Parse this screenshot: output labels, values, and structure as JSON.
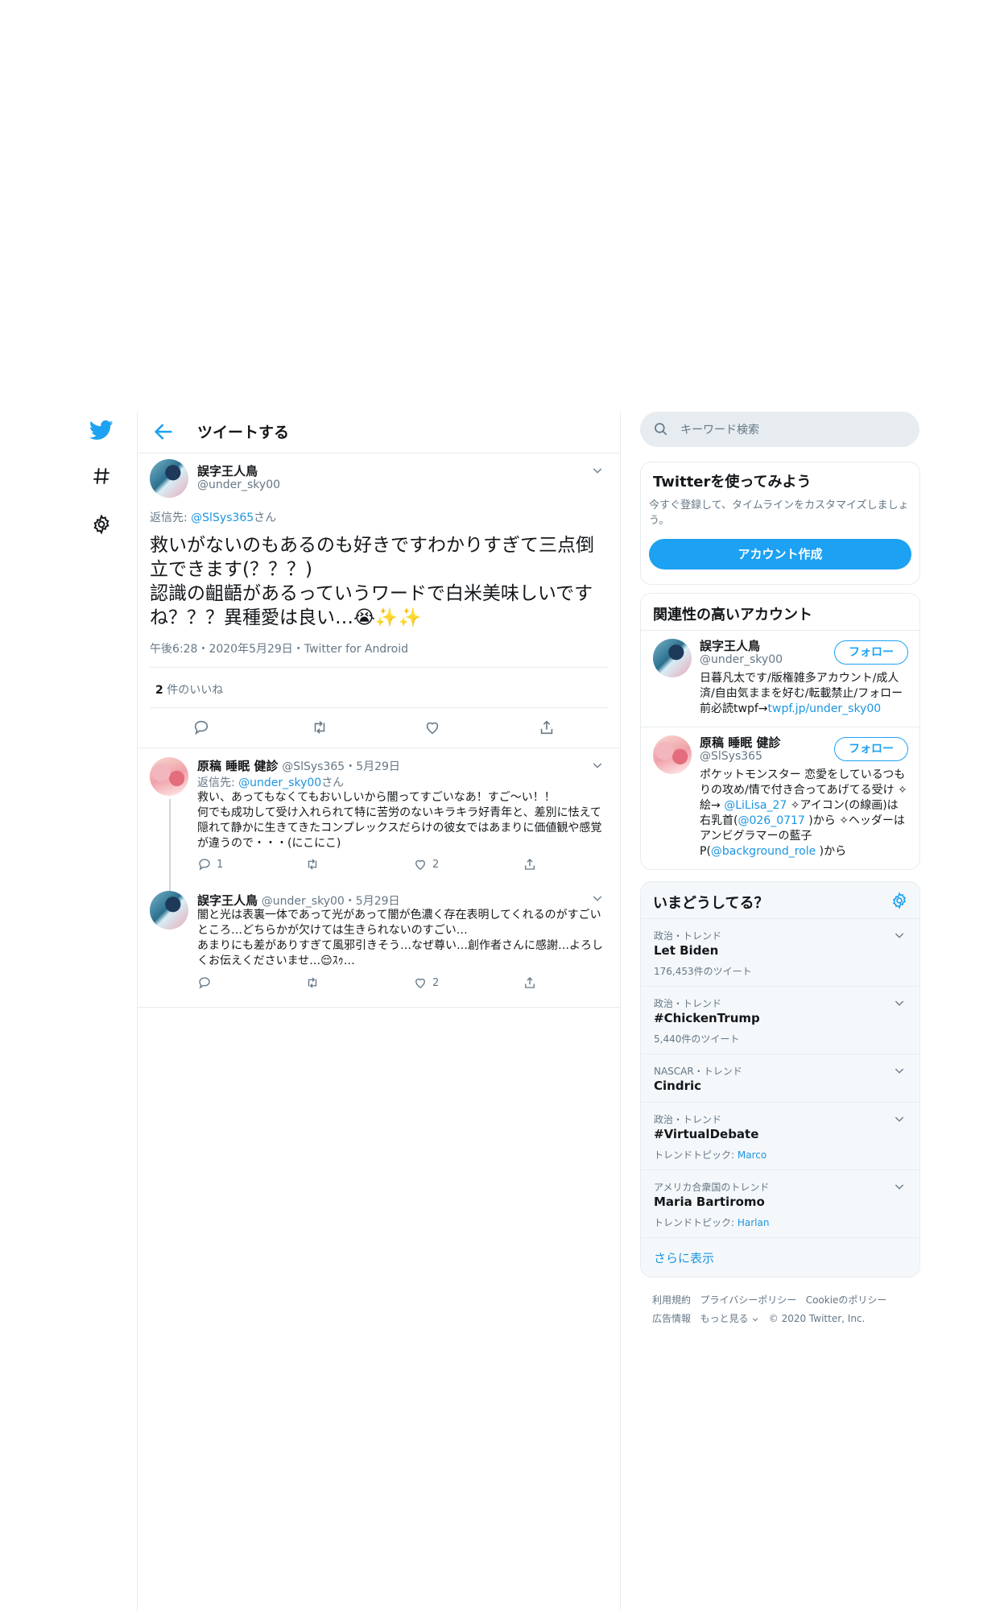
{
  "nav": {
    "twitter_logo": "twitter-bird-icon",
    "explore_icon": "hashtag-icon",
    "settings_icon": "gear-icon"
  },
  "header": {
    "title": "ツイートする"
  },
  "main_tweet": {
    "display_name": "誤字王人鳥",
    "handle": "@under_sky00",
    "reply_prefix": "返信先: ",
    "reply_to": "@SlSys365",
    "reply_suffix": "さん",
    "text": "救いがないのもあるのも好きですわかりすぎて三点倒立できます(？？？)\n認識の齟齬があるっていうワードで白米美味しいですね？？？異種愛は良い…😭✨✨",
    "meta": "午後6:28・2020年5月29日・Twitter for Android",
    "likes_count": "2",
    "likes_label": " 件のいいね"
  },
  "replies": [
    {
      "display_name": "原稿 睡眠 健診",
      "handle_date": "@SlSys365・5月29日",
      "reply_prefix": "返信先: ",
      "reply_to": "@under_sky00",
      "reply_suffix": "さん",
      "text": "救い、あってもなくてもおいしいから闇ってすごいなあ！すご〜い！！\n何でも成功して受け入れられて特に苦労のないキラキラ好青年と、差別に怯えて隠れて静かに生きてきたコンプレックスだらけの彼女ではあまりに価値観や感覚が違うので・・・(にこにこ)",
      "reply_count": "1",
      "like_count": "2"
    },
    {
      "display_name": "誤字王人鳥",
      "handle_date": "@under_sky00・5月29日",
      "text": "闇と光は表裏一体であって光があって闇が色濃く存在表明してくれるのがすごいところ…どちらかが欠けては生きられないのすごい…\nあまりにも差がありすぎて風邪引きそう…なぜ尊い…創作者さんに感謝…よろしくお伝えくださいませ…😌ｽｩ…",
      "like_count": "2"
    }
  ],
  "search": {
    "placeholder": "キーワード検索"
  },
  "signup": {
    "title": "Twitterを使ってみよう",
    "text": "今すぐ登録して、タイムラインをカスタマイズしましょう。",
    "button": "アカウント作成"
  },
  "related": {
    "title": "関連性の高いアカウント",
    "follow_label": "フォロー",
    "accounts": [
      {
        "name": "誤字王人鳥",
        "handle": "@under_sky00",
        "bio": "日暮凡太です/版権雑多アカウント/成人済/自由気ままを好む/転載禁止/フォロー前必読twpf→",
        "bio_link": "twpf.jp/under_sky00"
      },
      {
        "name": "原稿 睡眠 健診",
        "handle": "@SlSys365",
        "bio1": "ポケットモンスター 恋愛をしているつもりの攻め/情で付き合ってあげてる受け ✧絵→ ",
        "link1": "@LiLisa_27",
        "bio2": " ✧アイコン(の線画)は右乳首(",
        "link2": "@026_0717",
        "bio3": " )から ✧ヘッダーはアンビグラマーの藍子P(",
        "link3": "@background_role",
        "bio4": " )から"
      }
    ]
  },
  "trends": {
    "title": "いまどうしてる？",
    "items": [
      {
        "category": "政治・トレンド",
        "name": "Let Biden",
        "sub": "176,453件のツイート"
      },
      {
        "category": "政治・トレンド",
        "name": "#ChickenTrump",
        "sub": "5,440件のツイート"
      },
      {
        "category": "NASCAR・トレンド",
        "name": "Cindric",
        "sub": ""
      },
      {
        "category": "政治・トレンド",
        "name": "#VirtualDebate",
        "sub": "トレンドトピック: ",
        "sub_link": "Marco"
      },
      {
        "category": "アメリカ合衆国のトレンド",
        "name": "Maria Bartiromo",
        "sub": "トレンドトピック: ",
        "sub_link": "Harlan"
      }
    ],
    "show_more": "さらに表示"
  },
  "footer": {
    "terms": "利用規約",
    "privacy": "プライバシーポリシー",
    "cookie": "Cookieのポリシー",
    "ads": "広告情報",
    "more": "もっと見る",
    "copyright": "© 2020 Twitter, Inc."
  },
  "colors": {
    "accent": "#1da1f2",
    "link": "#1b95e0",
    "muted": "#657786",
    "border": "#e6ecf0",
    "panel": "#f5f8fa"
  }
}
